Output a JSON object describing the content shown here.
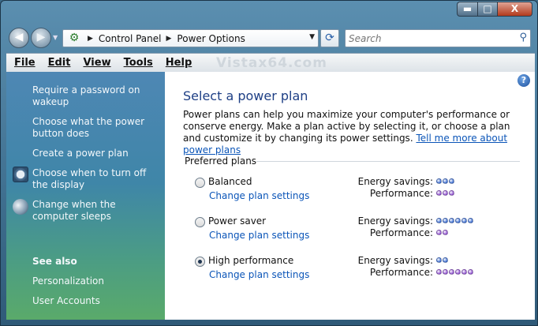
{
  "window": {
    "caption_buttons": {
      "minimize": "▬",
      "maximize": "□",
      "close": "X"
    }
  },
  "navigation": {
    "back_icon": "back-arrow-icon",
    "forward_icon": "forward-arrow-icon",
    "breadcrumbs": [
      "Control Panel",
      "Power Options"
    ],
    "search_placeholder": "Search"
  },
  "menu": {
    "items": [
      "File",
      "Edit",
      "View",
      "Tools",
      "Help"
    ],
    "watermark": "Vistax64.com"
  },
  "sidebar": {
    "tasks": [
      {
        "label": "Require a password on wakeup"
      },
      {
        "label": "Choose what the power button does"
      },
      {
        "label": "Create a power plan"
      },
      {
        "label": "Choose when to turn off the display",
        "icon": "monitor-clock-icon"
      },
      {
        "label": "Change when the computer sleeps",
        "icon": "sleep-moon-icon"
      }
    ],
    "see_also_title": "See also",
    "see_also": [
      "Personalization",
      "User Accounts"
    ]
  },
  "main": {
    "title": "Select a power plan",
    "description": "Power plans can help you maximize your computer's performance or conserve energy. Make a plan active by selecting it, or choose a plan and customize it by changing its power settings.",
    "more_link": "Tell me more about power plans",
    "group_label": "Preferred plans",
    "energy_label": "Energy savings:",
    "performance_label": "Performance:",
    "plans": [
      {
        "name": "Balanced",
        "link": "Change plan settings",
        "selected": false,
        "energy_savings": 3,
        "performance": 3
      },
      {
        "name": "Power saver",
        "link": "Change plan settings",
        "selected": false,
        "energy_savings": 6,
        "performance": 2
      },
      {
        "name": "High performance",
        "link": "Change plan settings",
        "selected": true,
        "energy_savings": 2,
        "performance": 6
      }
    ]
  },
  "colors": {
    "energy_dot": "#4a79d8",
    "performance_dot": "#9a5fd6",
    "title": "#1e3f85",
    "link": "#0b55b8"
  }
}
